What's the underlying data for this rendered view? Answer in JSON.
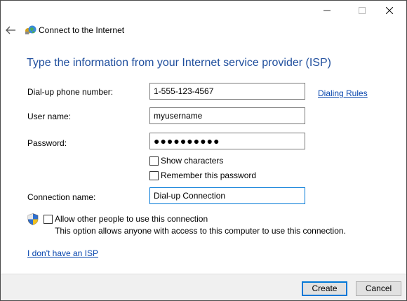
{
  "window": {
    "controls": {
      "minimize": "minimize-icon",
      "maximize": "maximize-icon",
      "close": "close-icon"
    }
  },
  "nav": {
    "title": "Connect to the Internet",
    "back_icon": "back-arrow-icon",
    "app_icon": "network-globe-icon"
  },
  "heading": "Type the information from your Internet service provider (ISP)",
  "form": {
    "phone_label": "Dial-up phone number:",
    "phone_value": "1-555-123-4567",
    "dialing_rules_link": "Dialing Rules",
    "username_label": "User name:",
    "username_value": "myusername",
    "password_label": "Password:",
    "password_value": "●●●●●●●●●●",
    "show_characters_label": "Show characters",
    "remember_password_label": "Remember this password",
    "connection_name_label": "Connection name:",
    "connection_name_value": "Dial-up Connection",
    "allow_others_label": "Allow other people to use this connection",
    "allow_others_note": "This option allows anyone with access to this computer to use this connection.",
    "shield_icon": "uac-shield-icon"
  },
  "no_isp_link": "I don't have an ISP",
  "buttons": {
    "create": "Create",
    "cancel": "Cancel"
  },
  "colors": {
    "heading": "#1f4e9d",
    "link": "#0645ad",
    "focus": "#0078d7",
    "footer_bg": "#f0f0f0"
  }
}
